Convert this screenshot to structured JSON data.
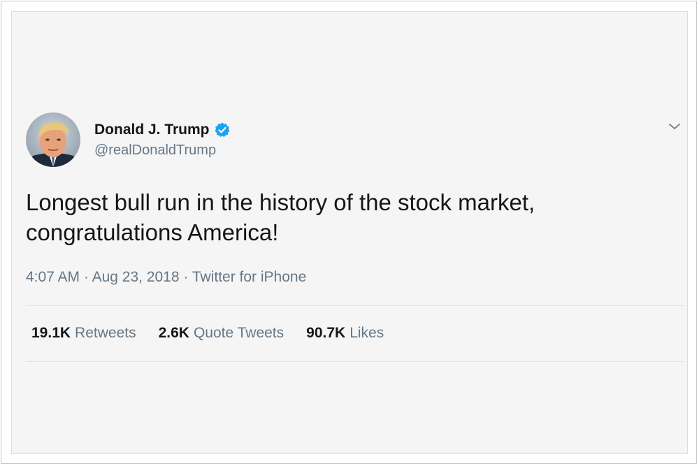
{
  "tweet": {
    "author_name": "Donald J. Trump",
    "handle": "@realDonaldTrump",
    "text": "Longest bull run in the history of the stock market, congratulations America!",
    "time": "4:07 AM",
    "date": "Aug 23, 2018",
    "source": "Twitter for iPhone",
    "separator": "·"
  },
  "stats": [
    {
      "count": "19.1K",
      "label": "Retweets"
    },
    {
      "count": "2.6K",
      "label": "Quote Tweets"
    },
    {
      "count": "90.7K",
      "label": "Likes"
    }
  ],
  "icons": {
    "verified": "verified-badge-icon",
    "caret": "chevron-down-icon",
    "avatar": "profile-avatar"
  },
  "colors": {
    "verified_blue": "#1da1f2",
    "text_primary": "#14171a",
    "text_secondary": "#657786",
    "background": "#f5f5f5"
  }
}
